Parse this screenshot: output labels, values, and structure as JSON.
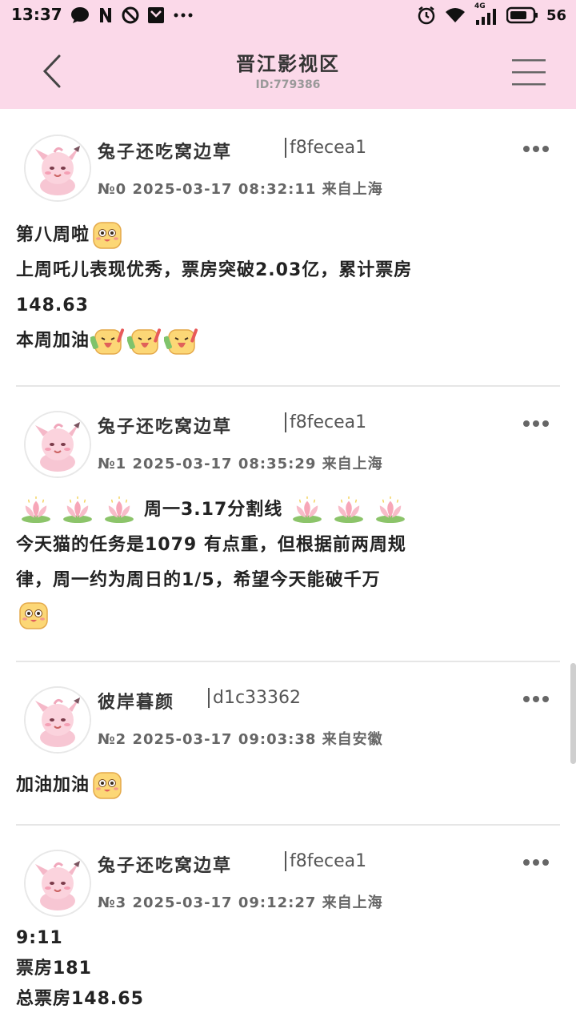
{
  "status_bar": {
    "time": "13:37",
    "network": "4G",
    "battery": "56",
    "left_icons": [
      "chat-bubble-icon",
      "n-icon",
      "blocked-icon",
      "mail-icon",
      "more-dots-icon"
    ],
    "right_icons": [
      "alarm-icon",
      "wifi-icon",
      "signal-icon",
      "battery-icon"
    ]
  },
  "header": {
    "title": "晋江影视区",
    "subtitle": "ID:779386",
    "bg_color": "#fbd9e9"
  },
  "posts": [
    {
      "username": "兔子还吃窝边草",
      "uid": "f8fecea1",
      "meta": "№0 2025-03-17 08:32:11 来自上海",
      "lines": [
        "第八周啦",
        "上周吒儿表现优秀，票房突破2.03亿，累计票房",
        "148.63",
        "本周加油"
      ]
    },
    {
      "username": "兔子还吃窝边草",
      "uid": "f8fecea1",
      "meta": "№1 2025-03-17 08:35:29 来自上海",
      "lines": [
        "周一3.17分割线",
        "今天猫的任务是1079 有点重，但根据前两周规",
        "律，周一约为周日的1/5，希望今天能破千万"
      ]
    },
    {
      "username": "彼岸暮颜",
      "uid": "d1c33362",
      "meta": "№2 2025-03-17 09:03:38 来自安徽",
      "lines": [
        "加油加油"
      ]
    },
    {
      "username": "兔子还吃窝边草",
      "uid": "f8fecea1",
      "meta": "№3 2025-03-17 09:12:27 来自上海",
      "lines": [
        "9:11",
        "票房181",
        "总票房148.65"
      ]
    }
  ]
}
